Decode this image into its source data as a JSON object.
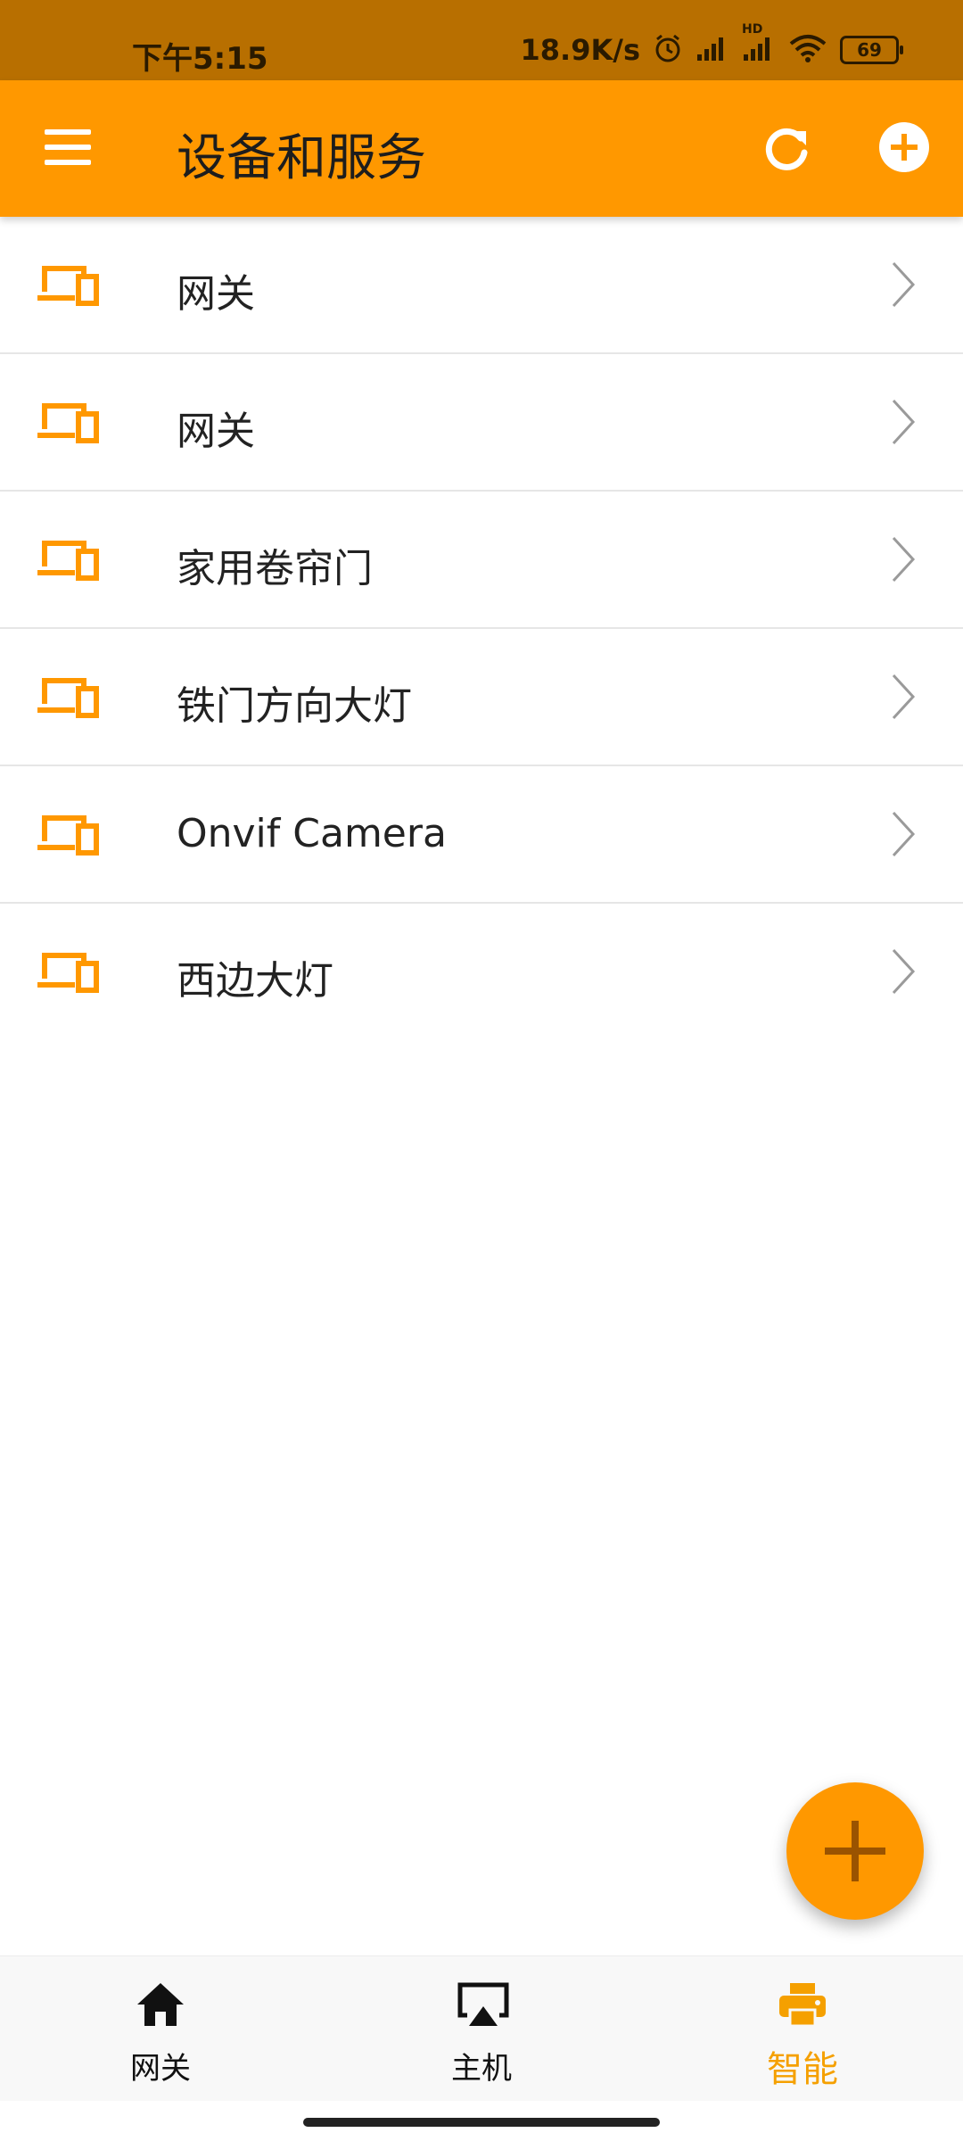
{
  "status_bar": {
    "time": "下午5:15",
    "net_speed": "18.9K/s",
    "battery": "69",
    "hd_label": "HD",
    "icons": [
      "alarm-icon",
      "signal-icon",
      "signal-hd-icon",
      "wifi-icon",
      "battery-icon"
    ]
  },
  "header": {
    "title": "设备和服务",
    "refresh_icon": "refresh-icon",
    "add_icon": "add-circle-icon",
    "menu_icon": "menu-icon"
  },
  "devices": [
    {
      "label": "网关",
      "icon": "devices-icon"
    },
    {
      "label": "网关",
      "icon": "devices-icon"
    },
    {
      "label": "家用卷帘门",
      "icon": "devices-icon"
    },
    {
      "label": "铁门方向大灯",
      "icon": "devices-icon"
    },
    {
      "label": "Onvif Camera",
      "icon": "devices-icon"
    },
    {
      "label": "西边大灯",
      "icon": "devices-icon"
    }
  ],
  "fab": {
    "icon": "plus-icon"
  },
  "bottom_nav": {
    "items": [
      {
        "label": "网关",
        "icon": "home-icon",
        "active": false
      },
      {
        "label": "主机",
        "icon": "airplay-icon",
        "active": false
      },
      {
        "label": "智能",
        "icon": "printer-icon",
        "active": true
      }
    ]
  },
  "colors": {
    "accent": "#ff9800",
    "status_bar": "#b86f00",
    "active_nav": "#f5a000"
  }
}
